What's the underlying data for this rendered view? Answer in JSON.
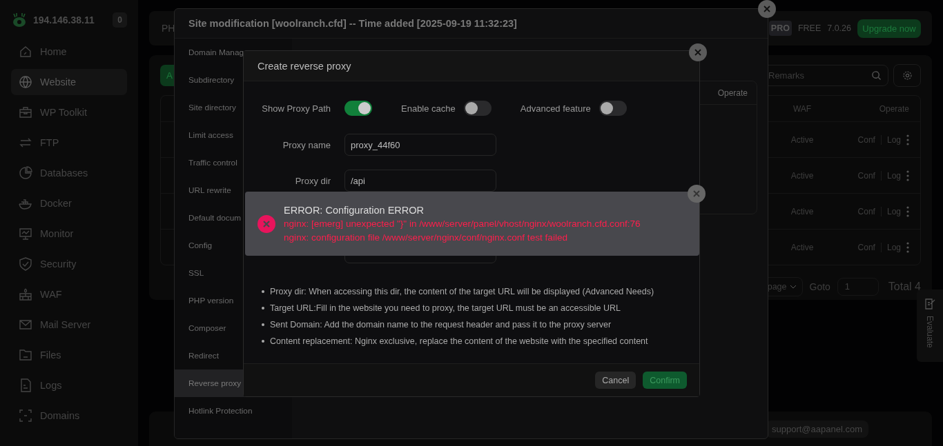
{
  "sidebar": {
    "server": "194.146.38.11",
    "badge": "0",
    "items": [
      {
        "label": "Home",
        "selected": false
      },
      {
        "label": "Website",
        "selected": true
      },
      {
        "label": "WP Toolkit",
        "selected": false
      },
      {
        "label": "FTP",
        "selected": false
      },
      {
        "label": "Databases",
        "selected": false
      },
      {
        "label": "Docker",
        "selected": false
      },
      {
        "label": "Monitor",
        "selected": false
      },
      {
        "label": "Security",
        "selected": false
      },
      {
        "label": "WAF",
        "selected": false
      },
      {
        "label": "Mail Server",
        "selected": false
      },
      {
        "label": "Files",
        "selected": false
      },
      {
        "label": "Logs",
        "selected": false
      },
      {
        "label": "Domains",
        "selected": false
      }
    ]
  },
  "header": {
    "tab": "PH",
    "plan_badge": "PRO",
    "plan": "FREE",
    "version": "7.0.26",
    "upgrade_button": "Upgrade now"
  },
  "site_list": {
    "add_button": "A",
    "search": {
      "placeholder": "Remarks"
    },
    "columns": [
      "WAF",
      "Operate"
    ],
    "rows": [
      {
        "waf": "Active",
        "actions": [
          "Conf",
          "Log"
        ]
      },
      {
        "waf": "Active",
        "actions": [
          "Conf",
          "Log"
        ]
      },
      {
        "waf": "Active",
        "actions": [
          "Conf",
          "Log"
        ]
      },
      {
        "waf": "Active",
        "actions": [
          "Conf",
          "Log"
        ]
      }
    ],
    "pagination": {
      "page_select": "page",
      "goto_label": "Goto",
      "goto_value": "1",
      "total": "Total 4"
    }
  },
  "footer": {
    "contact": "support@aapanel.com"
  },
  "feedback_tab": "Evaluate",
  "site_modal": {
    "title": "Site modification [woolranch.cfd] -- Time added [2025-09-19 11:32:23]",
    "menu": [
      {
        "label": "Domain Manag",
        "selected": false
      },
      {
        "label": "Subdirectory",
        "selected": false
      },
      {
        "label": "Site directory",
        "selected": false
      },
      {
        "label": "Limit access",
        "selected": false
      },
      {
        "label": "Traffic control",
        "selected": false
      },
      {
        "label": "URL rewrite",
        "selected": false
      },
      {
        "label": "Default docum",
        "selected": false
      },
      {
        "label": "Config",
        "selected": false
      },
      {
        "label": "SSL",
        "selected": false
      },
      {
        "label": "PHP version",
        "selected": false
      },
      {
        "label": "Composer",
        "selected": false
      },
      {
        "label": "Redirect",
        "selected": false
      },
      {
        "label": "Reverse proxy",
        "selected": true
      },
      {
        "label": "Hotlink Protection",
        "selected": false
      }
    ],
    "table": {
      "columns": [
        "Operate"
      ]
    }
  },
  "proxy_modal": {
    "title": "Create reverse proxy",
    "switches": [
      {
        "label": "Show Proxy Path",
        "on": true
      },
      {
        "label": "Enable cache",
        "on": false
      },
      {
        "label": "Advanced feature",
        "on": false
      }
    ],
    "fields": [
      {
        "label": "Proxy name",
        "value": "proxy_44f60"
      },
      {
        "label": "Proxy dir",
        "value": "/api"
      }
    ],
    "notes": [
      "Proxy dir: When accessing this dir, the content of the target URL will be displayed (Advanced Needs)",
      "Target URL:Fill in the website you need to proxy, the target URL must be an accessible URL",
      "Sent Domain: Add the domain name to the request header and pass it to the proxy server",
      "Content replacement: Nginx exclusive, replace the content of the website with the specified content"
    ],
    "buttons": [
      {
        "label": "Cancel",
        "kind": "secondary"
      },
      {
        "label": "Confirm",
        "kind": "primary"
      }
    ]
  },
  "error_toast": {
    "title": "ERROR: Configuration ERROR",
    "lines": [
      "nginx: [emerg] unexpected \"}\" in /www/server/panel/vhost/nginx/woolranch.cfd.conf:76",
      "nginx: configuration file /www/server/nginx/conf/nginx.conf test failed"
    ]
  }
}
